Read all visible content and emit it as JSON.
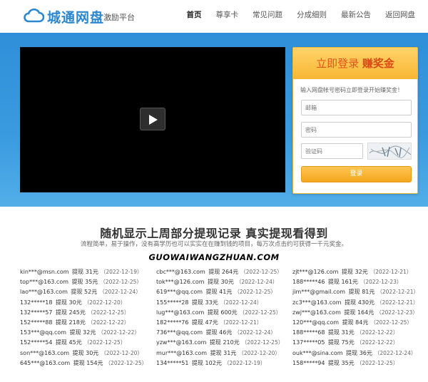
{
  "header": {
    "logo_text": "城通网盘",
    "logo_sub": "激励平台",
    "nav": [
      {
        "label": "首页",
        "active": true
      },
      {
        "label": "尊享卡",
        "active": false
      },
      {
        "label": "常见问题",
        "active": false
      },
      {
        "label": "分成细则",
        "active": false
      },
      {
        "label": "最新公告",
        "active": false
      },
      {
        "label": "返回网盘",
        "active": false
      }
    ]
  },
  "login": {
    "title_part1": "立即登录",
    "title_part2": "赚奖金",
    "tip": "输入网盘帐号密码立即登录开始赚奖金！",
    "username_placeholder": "邮箱",
    "password_placeholder": "密码",
    "captcha_placeholder": "验证码",
    "button_label": "登录"
  },
  "section": {
    "title": "随机显示上周部分提现记录 真实提现看得到",
    "subtitle": "流程简单，易于操作，没有高学历也可以实实在在赚到钱的项目，每万次点击约可获得一千元奖金。",
    "watermark": "GUOWAIWANGZHUAN.COM"
  },
  "records": {
    "action_word": "提现",
    "columns": [
      [
        {
          "email": "kin***@msn.com",
          "amount": "31元",
          "date": "（2022-12-19）"
        },
        {
          "email": "top***@163.com",
          "amount": "35元",
          "date": "（2022-12-25）"
        },
        {
          "email": "lao***@163.com",
          "amount": "52元",
          "date": "（2022-12-24）"
        },
        {
          "email": "132*****18",
          "amount": "30元",
          "date": "（2022-12-20）"
        },
        {
          "email": "132*****57",
          "amount": "245元",
          "date": "（2022-12-25）"
        },
        {
          "email": "152*****88",
          "amount": "218元",
          "date": "（2022-12-22）"
        },
        {
          "email": "153***@qq.com",
          "amount": "32元",
          "date": "（2022-12-22）"
        },
        {
          "email": "152*****54",
          "amount": "45元",
          "date": "（2022-12-25）"
        },
        {
          "email": "son***@163.com",
          "amount": "30元",
          "date": "（2022-12-20）"
        },
        {
          "email": "645***@163.com",
          "amount": "154元",
          "date": "（2022-12-25）"
        }
      ],
      [
        {
          "email": "cbc***@163.com",
          "amount": "264元",
          "date": "（2022-12-25）"
        },
        {
          "email": "tok***@126.com",
          "amount": "30元",
          "date": "（2022-12-24）"
        },
        {
          "email": "619***@qq.com",
          "amount": "41元",
          "date": "（2022-12-25）"
        },
        {
          "email": "155*****28",
          "amount": "33元",
          "date": "（2022-12-24）"
        },
        {
          "email": "lug***@163.com",
          "amount": "600元",
          "date": "（2022-12-25）"
        },
        {
          "email": "182*****76",
          "amount": "47元",
          "date": "（2022-12-21）"
        },
        {
          "email": "736***@qq.com",
          "amount": "46元",
          "date": "（2022-12-24）"
        },
        {
          "email": "yzw***@163.com",
          "amount": "210元",
          "date": "（2022-12-25）"
        },
        {
          "email": "mur***@163.com",
          "amount": "31元",
          "date": "（2022-12-20）"
        },
        {
          "email": "134*****51",
          "amount": "102元",
          "date": "（2022-12-19）"
        }
      ],
      [
        {
          "email": "zjt***@126.com",
          "amount": "32元",
          "date": "（2022-12-21）"
        },
        {
          "email": "188*****46",
          "amount": "161元",
          "date": "（2022-12-23）"
        },
        {
          "email": "jim***@gmail.com",
          "amount": "81元",
          "date": "（2022-12-21）"
        },
        {
          "email": "zc3***@163.com",
          "amount": "430元",
          "date": "（2022-12-21）"
        },
        {
          "email": "zwj***@163.com",
          "amount": "164元",
          "date": "（2022-12-23）"
        },
        {
          "email": "120***@qq.com",
          "amount": "84元",
          "date": "（2022-12-25）"
        },
        {
          "email": "188*****68",
          "amount": "31元",
          "date": "（2022-12-22）"
        },
        {
          "email": "137*****05",
          "amount": "75元",
          "date": "（2022-12-22）"
        },
        {
          "email": "ouk***@sina.com",
          "amount": "36元",
          "date": "（2022-12-24）"
        },
        {
          "email": "158*****94",
          "amount": "35元",
          "date": "（2022-12-25）"
        }
      ]
    ]
  },
  "colors": {
    "brand_blue": "#2a87d0",
    "hero_blue": "#3a9be0",
    "login_orange": "#f9b733",
    "login_title_red": "#e2541b"
  }
}
